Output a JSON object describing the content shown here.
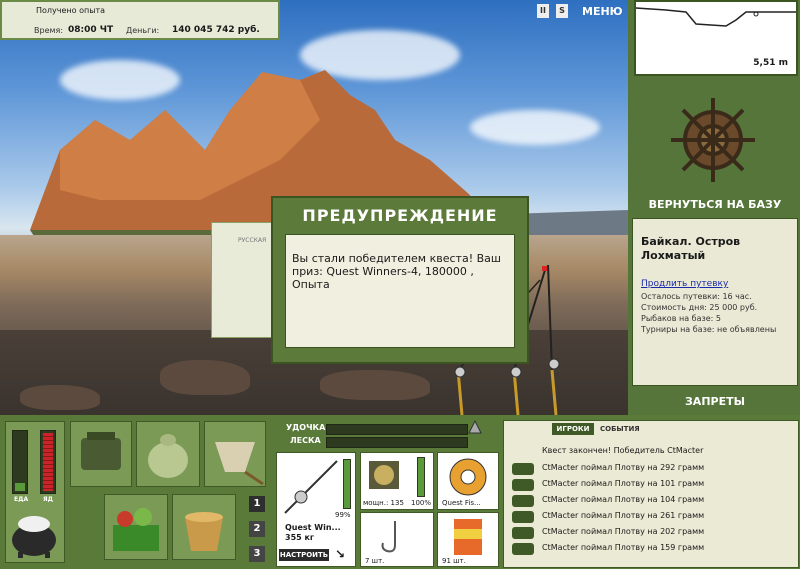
{
  "top_info": {
    "experience_label": "Получено опыта",
    "time_label": "Время:",
    "time_value": "08:00 ЧТ",
    "money_label": "Деньги:",
    "money_value": "140 045 742 руб."
  },
  "header": {
    "pause_glyph": "II",
    "sound_glyph": "S",
    "menu_label": "МЕНЮ"
  },
  "depth": {
    "value": "5,51 m"
  },
  "right_panel": {
    "return_base_label": "ВЕРНУТЬСЯ НА БАЗУ",
    "location_title": "Байкал. Остров Лохматый",
    "extend_trip_link": "Продлить путевку",
    "trip_left": "Осталось путевки: 16 час.",
    "day_cost": "Стоимость дня: 25 000 руб.",
    "anglers": "Рыбаков на базе: 5",
    "tournaments": "Турниры на базе: не объявлены",
    "bans_label": "ЗАПРЕТЫ"
  },
  "dialog": {
    "title": "ПРЕДУПРЕЖДЕНИЕ",
    "message": "Вы стали победителем квеста! Ваш приз: Quest Winners-4, 180000 , Опыта",
    "behind_label": "РУССКАЯ"
  },
  "status_bars": {
    "food_label": "ЕДА",
    "energy_label": "ЯД"
  },
  "tackle": {
    "rod_label": "УДОЧКА",
    "line_label": "ЛЕСКА",
    "rod_item_name": "Quest Win...",
    "rod_item_weight": "355 кг",
    "setup_button": "НАСТРОИТЬ",
    "rod_condition": "99%",
    "reel_power": "мощн.: 135",
    "reel_condition": "100%",
    "line_item_name": "Quest Fis...",
    "hook_count": "7 шт.",
    "bait_count": "91 шт."
  },
  "pages": [
    "1",
    "2",
    "3"
  ],
  "events": {
    "tab_players": "ИГРОКИ",
    "tab_events": "СОБЫТИЯ",
    "quest_line": "Квест закончен! Победитель CtMacter",
    "catches": [
      "CtMacter поймал Плотву на 292 грамм",
      "CtMacter поймал Плотву на 101 грамм",
      "CtMacter поймал Плотву на 104 грамм",
      "CtMacter поймал Плотву на 261 грамм",
      "CtMacter поймал Плотву на 202 грамм",
      "CtMacter поймал Плотву на 159 грамм"
    ]
  },
  "colors": {
    "panel_green": "#5a7a3a",
    "dark_green": "#3f5a26",
    "cream": "#ebead5",
    "link_blue": "#1a2aa8",
    "food_bar": "#5a9a3a",
    "energy_bar": "#c8242a"
  }
}
